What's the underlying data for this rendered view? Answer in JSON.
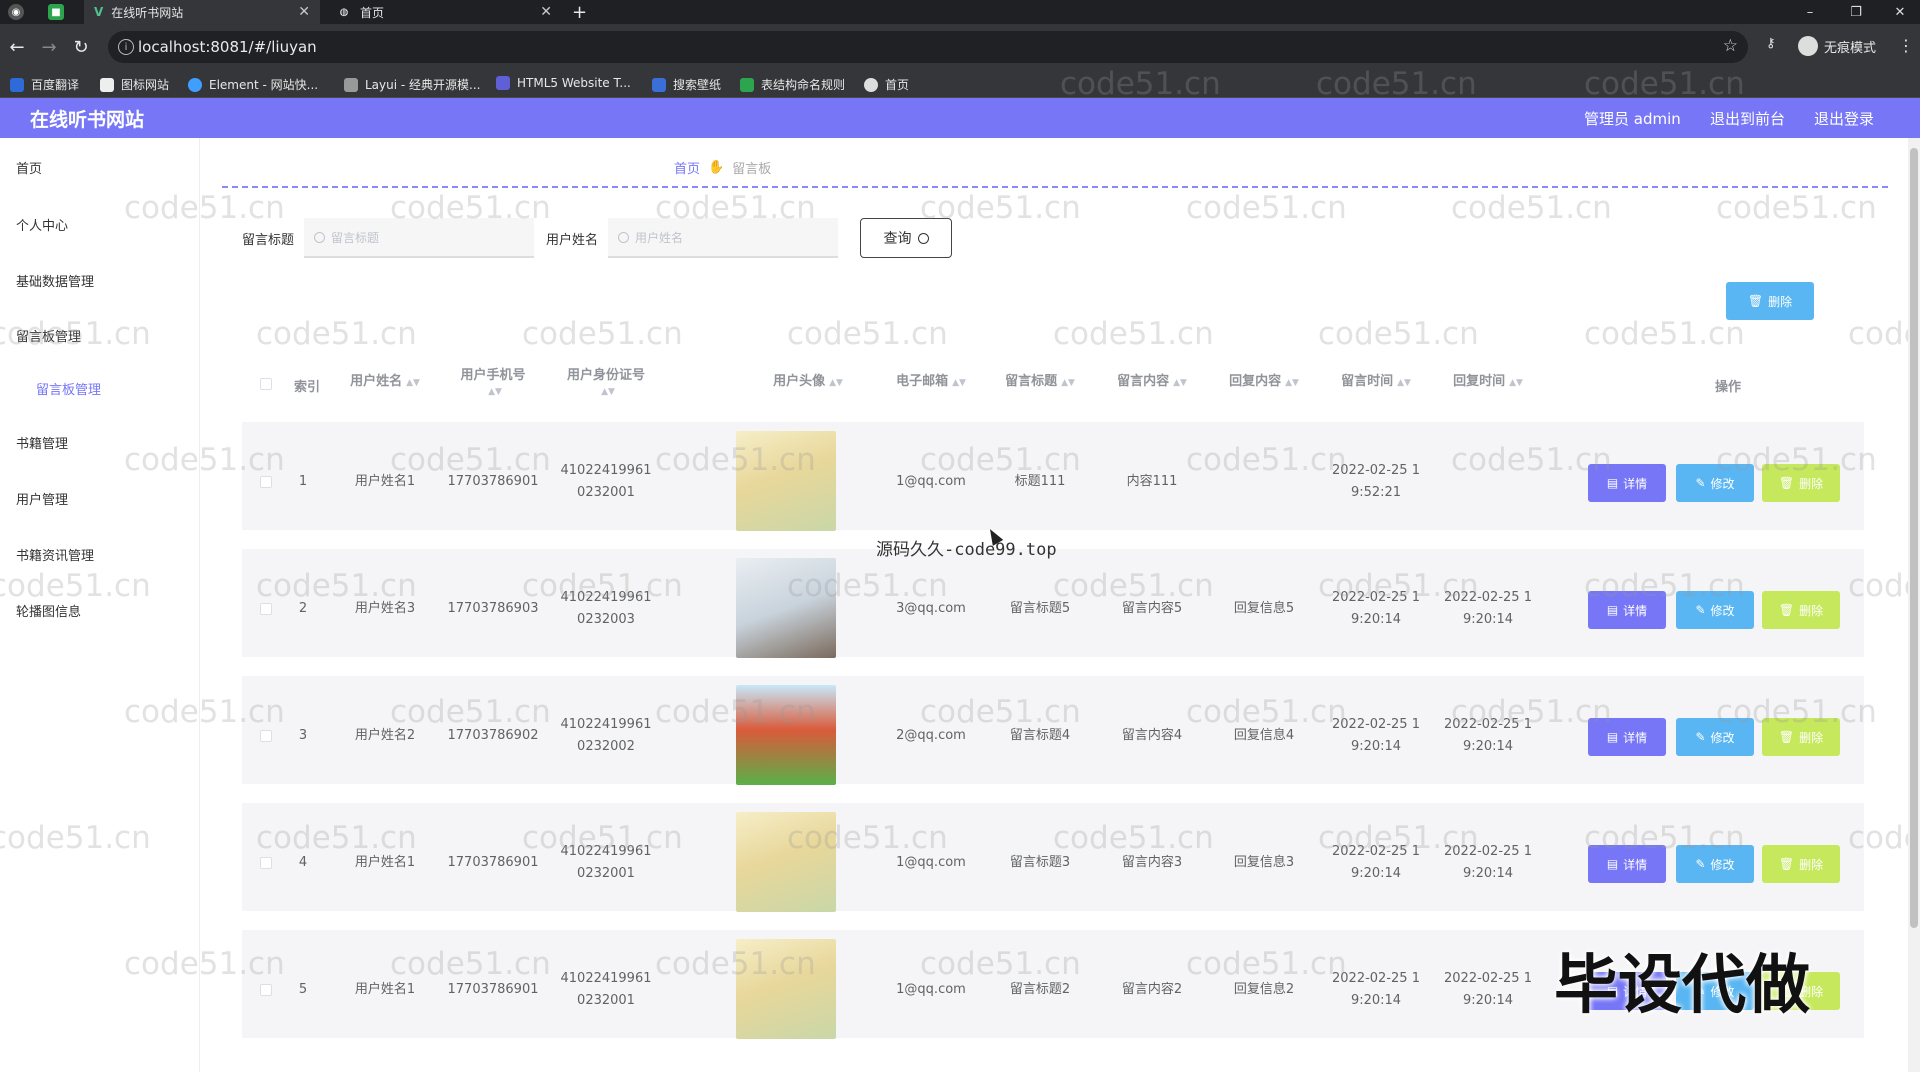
{
  "browser": {
    "tabs": [
      {
        "title": "在线听书网站",
        "active": true
      },
      {
        "title": "首页",
        "active": false
      }
    ],
    "url": "localhost:8081/#/liuyan",
    "profile_label": "无痕模式",
    "bookmarks": [
      "百度翻译",
      "图标网站",
      "Element - 网站快...",
      "Layui - 经典开源模...",
      "HTML5 Website T...",
      "搜索壁纸",
      "表结构命名规则",
      "首页"
    ]
  },
  "header": {
    "app_title": "在线听书网站",
    "admin_label": "管理员 admin",
    "back_front": "退出到前台",
    "logout": "退出登录"
  },
  "sidebar": {
    "items": [
      "首页",
      "个人中心",
      "基础数据管理",
      "留言板管理",
      "书籍管理",
      "用户管理",
      "书籍资讯管理",
      "轮播图信息"
    ],
    "sub_item": "留言板管理"
  },
  "breadcrumb": {
    "home": "首页",
    "current": "留言板"
  },
  "search": {
    "title_label": "留言标题",
    "title_placeholder": "留言标题",
    "user_label": "用户姓名",
    "user_placeholder": "用户姓名",
    "query_button": "查询"
  },
  "bulk_delete_label": "删除",
  "table": {
    "headers": [
      "索引",
      "用户姓名",
      "用户手机号",
      "用户身份证号",
      "用户头像",
      "电子邮箱",
      "留言标题",
      "留言内容",
      "回复内容",
      "留言时间",
      "回复时间",
      "操作"
    ],
    "rows": [
      {
        "index": "1",
        "name": "用户姓名1",
        "phone": "17703786901",
        "id1": "41022419961",
        "id2": "0232001",
        "email": "1@qq.com",
        "title": "标题111",
        "content": "内容111",
        "reply": "",
        "time1": "2022-02-25 1",
        "time2": "9:52:21",
        "rtime1": "",
        "rtime2": ""
      },
      {
        "index": "2",
        "name": "用户姓名3",
        "phone": "17703786903",
        "id1": "41022419961",
        "id2": "0232003",
        "email": "3@qq.com",
        "title": "留言标题5",
        "content": "留言内容5",
        "reply": "回复信息5",
        "time1": "2022-02-25 1",
        "time2": "9:20:14",
        "rtime1": "2022-02-25 1",
        "rtime2": "9:20:14"
      },
      {
        "index": "3",
        "name": "用户姓名2",
        "phone": "17703786902",
        "id1": "41022419961",
        "id2": "0232002",
        "email": "2@qq.com",
        "title": "留言标题4",
        "content": "留言内容4",
        "reply": "回复信息4",
        "time1": "2022-02-25 1",
        "time2": "9:20:14",
        "rtime1": "2022-02-25 1",
        "rtime2": "9:20:14"
      },
      {
        "index": "4",
        "name": "用户姓名1",
        "phone": "17703786901",
        "id1": "41022419961",
        "id2": "0232001",
        "email": "1@qq.com",
        "title": "留言标题3",
        "content": "留言内容3",
        "reply": "回复信息3",
        "time1": "2022-02-25 1",
        "time2": "9:20:14",
        "rtime1": "2022-02-25 1",
        "rtime2": "9:20:14"
      },
      {
        "index": "5",
        "name": "用户姓名1",
        "phone": "17703786901",
        "id1": "41022419961",
        "id2": "0232001",
        "email": "1@qq.com",
        "title": "留言标题2",
        "content": "留言内容2",
        "reply": "回复信息2",
        "time1": "2022-02-25 1",
        "time2": "9:20:14",
        "rtime1": "2022-02-25 1",
        "rtime2": "9:20:14"
      }
    ],
    "actions": {
      "detail": "详情",
      "edit": "修改",
      "delete": "删除"
    }
  },
  "overlays": {
    "watermark": "code51.cn",
    "source_text": "源码久久-code99.top",
    "big_mark": "毕设代做"
  },
  "colors": {
    "primary": "#7676f7",
    "edit": "#5ab6f2",
    "delete": "#c6e85c"
  }
}
